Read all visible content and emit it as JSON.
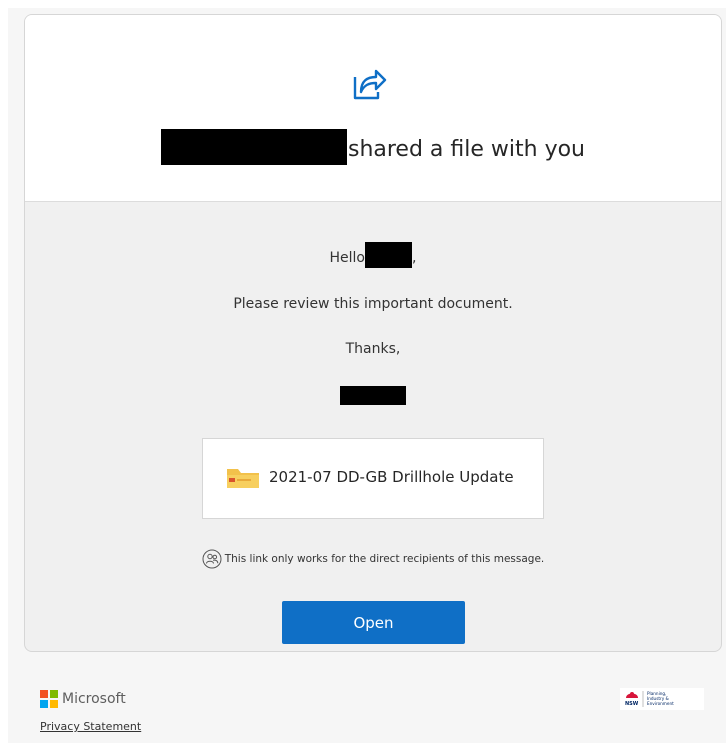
{
  "header": {
    "share_icon": "share-arrow-icon",
    "title_suffix": "shared a file with you"
  },
  "body": {
    "greeting": "Hello",
    "greeting_suffix": ",",
    "message": "Please review this important document.",
    "signoff": "Thanks,"
  },
  "file": {
    "icon": "folder-icon",
    "name": "2021-07 DD-GB Drillhole Update"
  },
  "notice": {
    "icon": "people-icon",
    "text": "This link only works for the direct recipients of this message."
  },
  "actions": {
    "open_label": "Open"
  },
  "footer": {
    "brand": "Microsoft",
    "privacy_label": "Privacy Statement",
    "nsw_logo_lines": [
      "Planning,",
      "Industry &",
      "Environment"
    ]
  },
  "colors": {
    "accent": "#0f6fc6",
    "folder": "#f2c14b",
    "card_bg": "#f0f0f0"
  }
}
